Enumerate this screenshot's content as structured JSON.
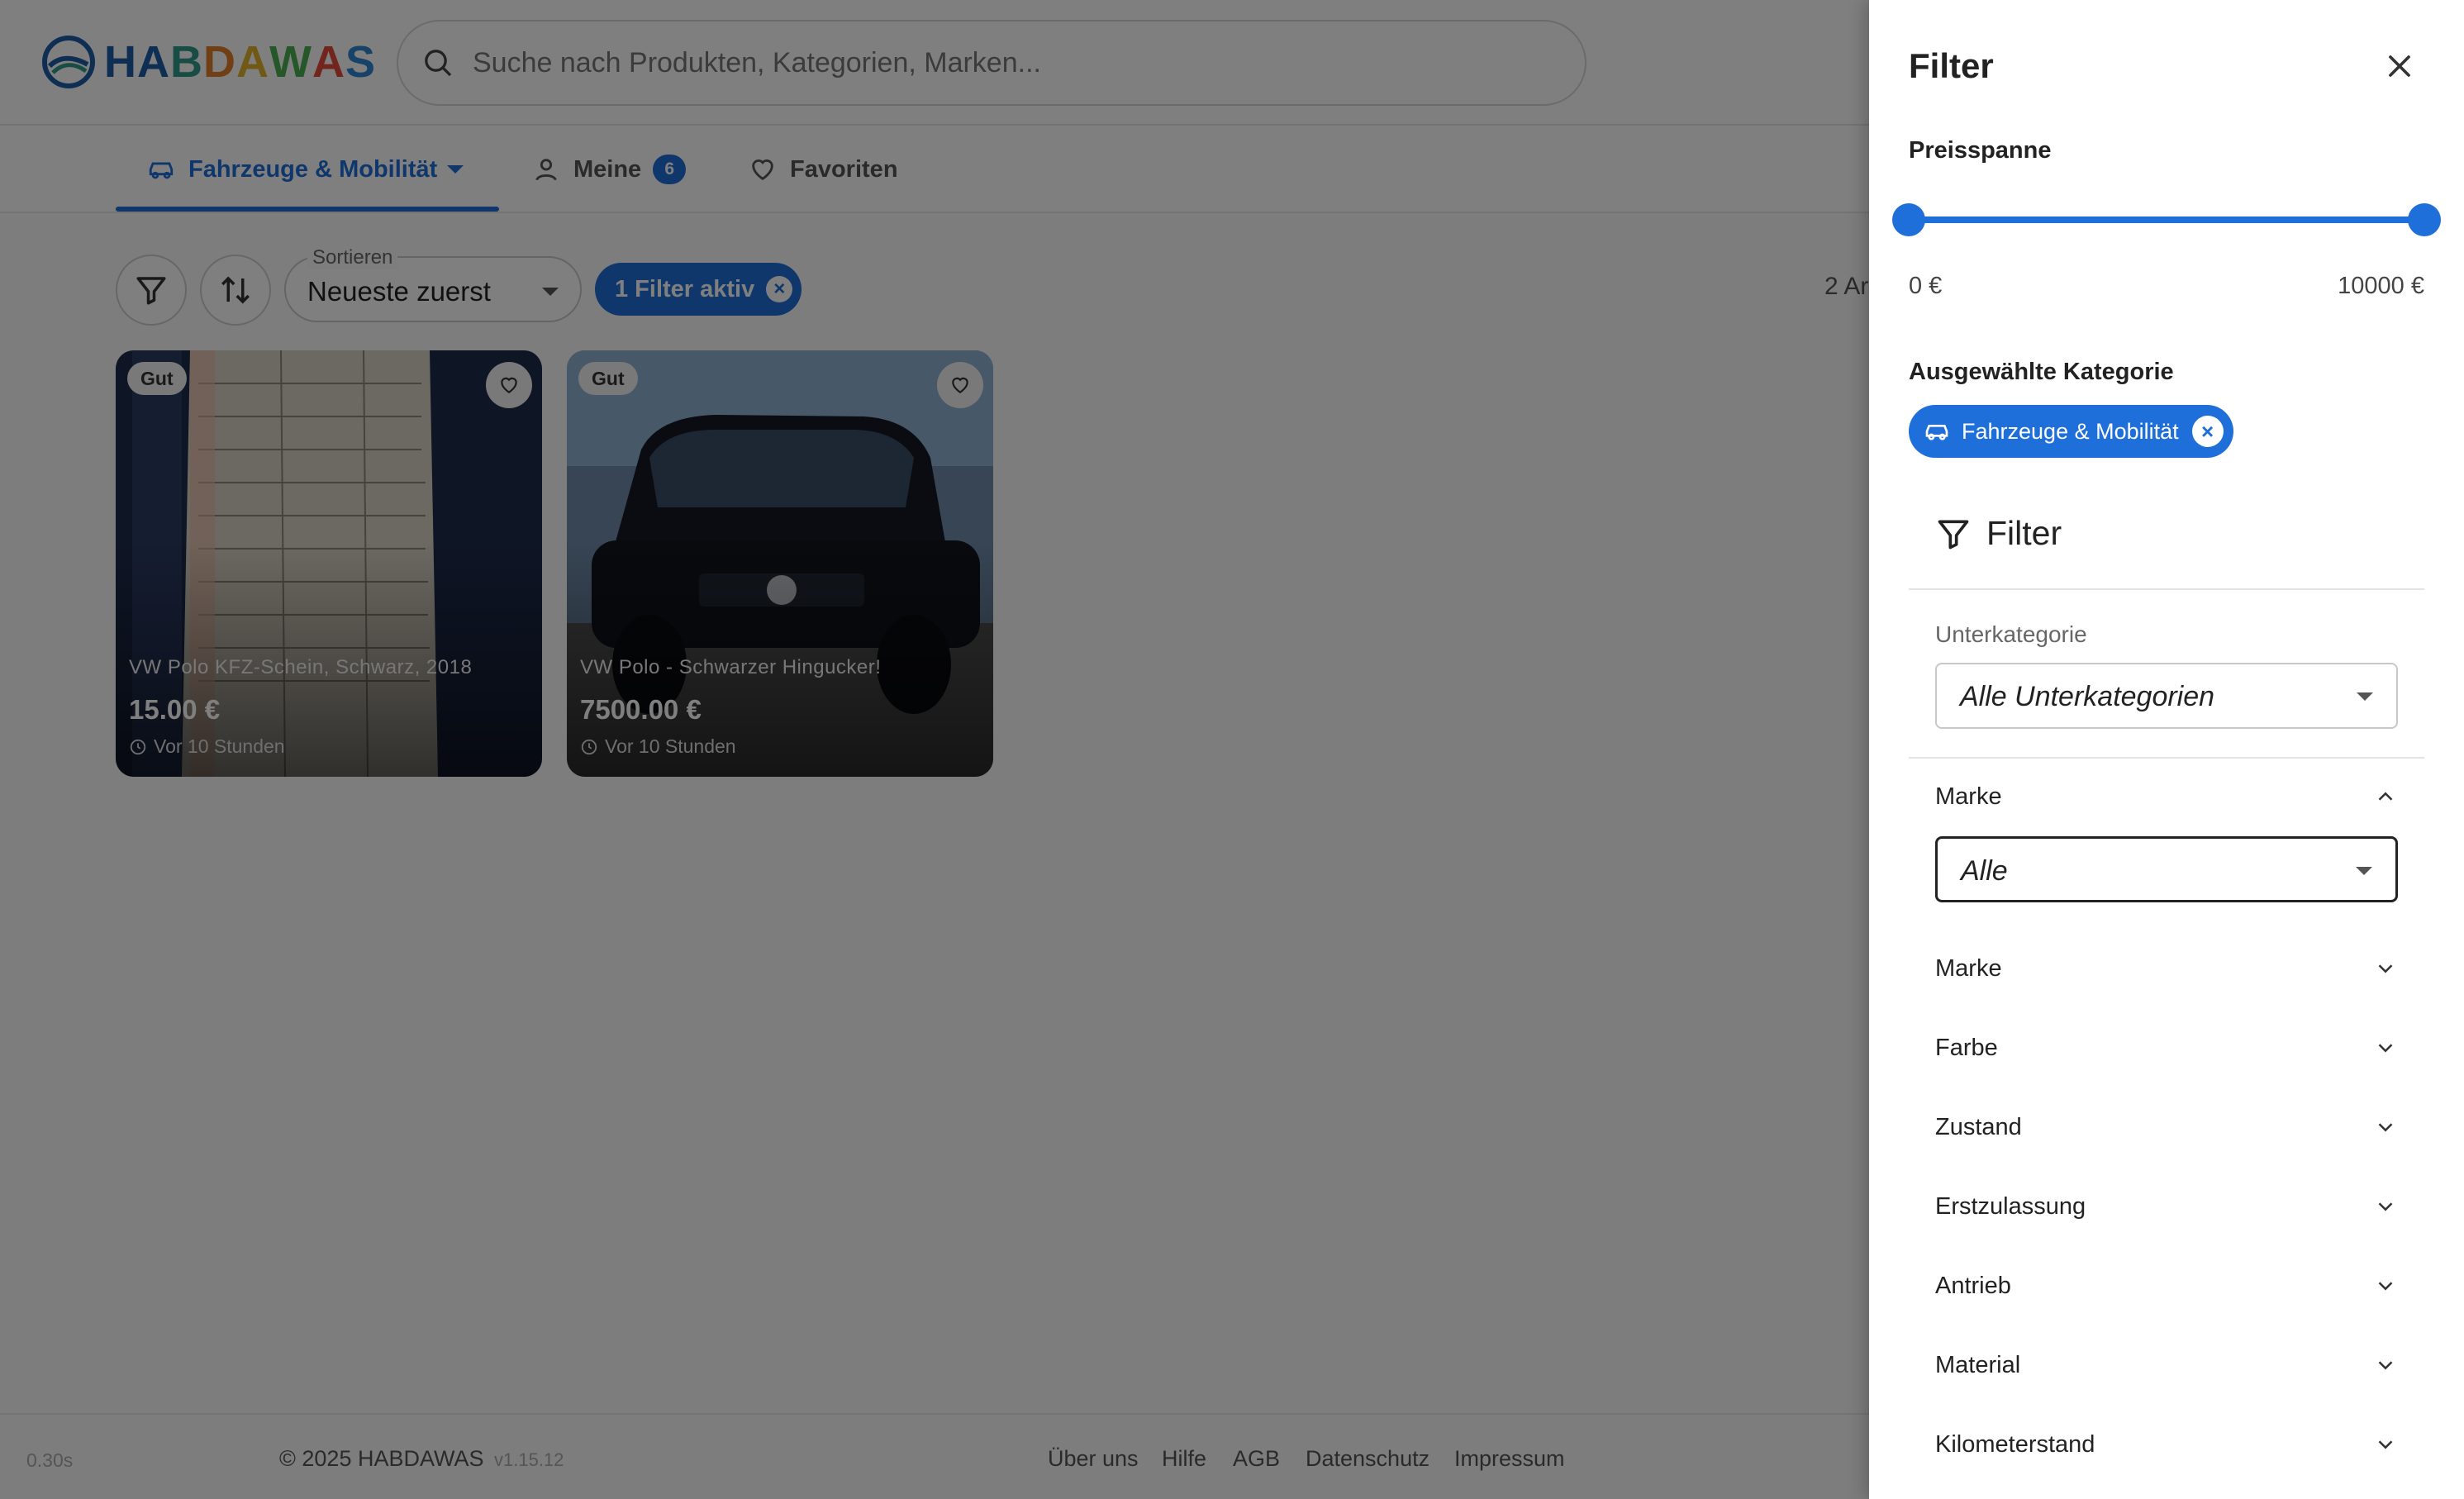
{
  "header": {
    "logo_text": "HABDAWAS",
    "logo_colors": [
      "#1e5ca6",
      "#1e5ca6",
      "#2e9b8a",
      "#e07f2a",
      "#e0b12a",
      "#4caf50",
      "#e24a3b",
      "#2f86d1"
    ],
    "search_placeholder": "Suche nach Produkten, Kategorien, Marken..."
  },
  "tabs": [
    {
      "label": "Fahrzeuge & Mobilität",
      "icon": "car-icon",
      "active": true
    },
    {
      "label": "Meine",
      "icon": "user-icon",
      "badge": "6"
    },
    {
      "label": "Favoriten",
      "icon": "heart-icon"
    }
  ],
  "toolbar": {
    "sort_label": "Sortieren",
    "sort_value": "Neueste zuerst",
    "active_filter_chip": "1 Filter aktiv",
    "result_count": "2 Ar"
  },
  "listings": [
    {
      "condition": "Gut",
      "title": "VW Polo KFZ-Schein, Schwarz, 2018",
      "price": "15.00 €",
      "time": "Vor 10 Stunden"
    },
    {
      "condition": "Gut",
      "title": "VW Polo - Schwarzer Hingucker!",
      "price": "7500.00 €",
      "time": "Vor 10 Stunden"
    }
  ],
  "footer": {
    "render_time": "0.30s",
    "copyright": "© 2025 HABDAWAS",
    "version": "v1.15.12",
    "links": [
      "Über uns",
      "Hilfe",
      "AGB",
      "Datenschutz",
      "Impressum"
    ]
  },
  "drawer": {
    "title": "Filter",
    "price_section": "Preisspanne",
    "price_min": "0 €",
    "price_max": "10000 €",
    "price_range_fraction": [
      0.0,
      1.0
    ],
    "category_section": "Ausgewählte Kategorie",
    "selected_category": "Fahrzeuge & Mobilität",
    "panel_title": "Filter",
    "subcategory_label": "Unterkategorie",
    "subcategory_value": "Alle Unterkategorien",
    "brand_expanded_label": "Marke",
    "brand_value": "Alle",
    "accordions": [
      "Marke",
      "Farbe",
      "Zustand",
      "Erstzulassung",
      "Antrieb",
      "Material",
      "Kilometerstand"
    ]
  },
  "colors": {
    "accent": "#1e6fd9",
    "backdrop": "rgba(0,0,0,0.5)"
  }
}
